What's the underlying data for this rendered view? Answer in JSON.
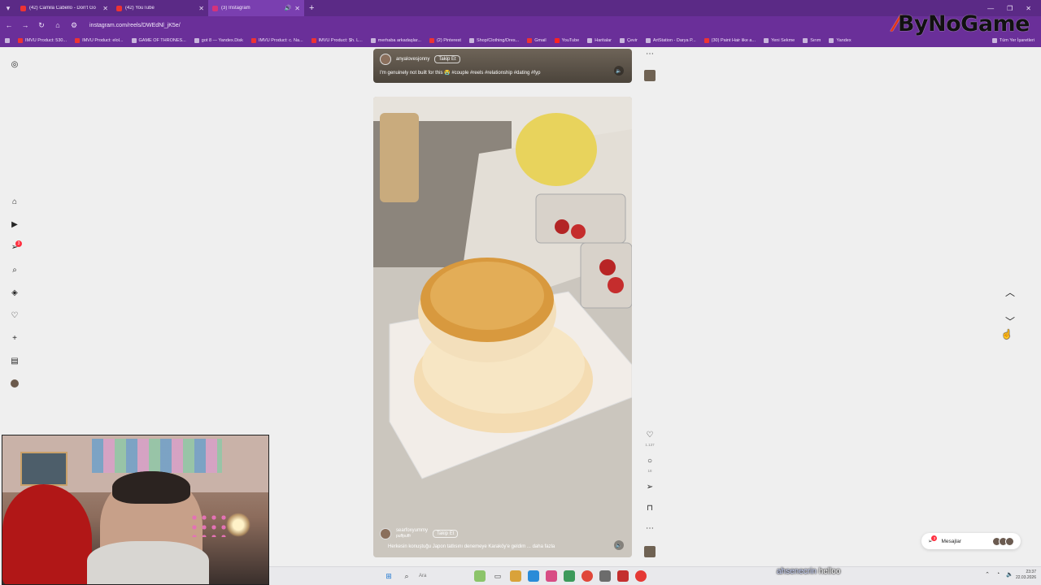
{
  "browser": {
    "tabs": [
      {
        "title": "(42) Camila Cabello - Don't Go",
        "favicon": "youtube-icon",
        "active": false
      },
      {
        "title": "(42) YouTube",
        "favicon": "youtube-icon",
        "active": false
      },
      {
        "title": "(3) Instagram",
        "favicon": "instagram-icon",
        "active": true
      }
    ],
    "new_tab_glyph": "+",
    "url": "instagram.com/reels/DWEdNl_jK5e/",
    "bookmarks": [
      "IMVU Product: 530...",
      "IMVU Product: elol...",
      "GAME OF THRONES...",
      "got 8 — Yandex.Disk",
      "IMVU Product: c. Na...",
      "IMVU Product: $h. L...",
      "merhaba arkadaşlar...",
      "(2) Pinterest",
      "Shop/Clothing/Dres...",
      "Gmail",
      "YouTube",
      "Haritalar",
      "Çevir",
      "ArtStation - Darya P...",
      "(30) Paint Hair like a...",
      "Yeni Sekme",
      "Sırım",
      "Yandex"
    ],
    "all_bookmarks": "Tüm Yer İşaretleri"
  },
  "watermark": {
    "brand": "ByNoGame"
  },
  "sidebar": {
    "notification_count": "3"
  },
  "reels": {
    "top": {
      "username": "anyalovesjonny",
      "follow_label": "Takip Et",
      "caption": "I'm genuinely not built for this 😭 #couple #reels #relationship #dating #fyp"
    },
    "main": {
      "username": "searfoxyummy",
      "audio": "puffpuffr",
      "follow_label": "Takip Et",
      "caption": "Herkesin konuştuğu Japon tatlısını denemeye Karaköy'e geldim ... daha fazla",
      "like_count": "1.137",
      "comment_count": "18"
    }
  },
  "messages": {
    "label": "Mesajlar",
    "badge": "3"
  },
  "chat": {
    "user": "ahsenecrin",
    "message": "helloo"
  },
  "taskbar": {
    "search_placeholder": "Ara",
    "time": "23:37",
    "date": "22.03.2026"
  },
  "colors": {
    "browser_chrome": "#6a2f99",
    "tab_strip": "#5b2a86",
    "page_background": "#efefef",
    "notification_red": "#ff3040"
  }
}
